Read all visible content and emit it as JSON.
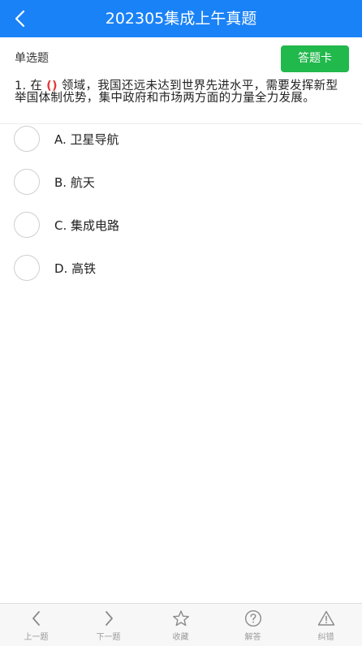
{
  "header": {
    "title": "202305集成上午真题",
    "back_icon": "chevron-left-icon",
    "background": "#1a82f7"
  },
  "question_bar": {
    "type_label": "单选题",
    "answer_card_label": "答题卡",
    "answer_card_color": "#21b84c"
  },
  "question": {
    "prefix": "1. 在",
    "blank": "()",
    "text": "领域，我国还远未达到世界先进水平，需要发挥新型举国体制优势，集中政府和市场两方面的力量全力发展。"
  },
  "options": [
    {
      "label": "A. 卫星导航"
    },
    {
      "label": "B. 航天"
    },
    {
      "label": "C. 集成电路"
    },
    {
      "label": "D. 高铁"
    }
  ],
  "bottom_nav": [
    {
      "label": "上一题",
      "icon": "chevron-left-icon"
    },
    {
      "label": "下一题",
      "icon": "chevron-right-icon"
    },
    {
      "label": "收藏",
      "icon": "star-icon"
    },
    {
      "label": "解答",
      "icon": "question-circle-icon"
    },
    {
      "label": "纠错",
      "icon": "warning-triangle-icon"
    }
  ]
}
